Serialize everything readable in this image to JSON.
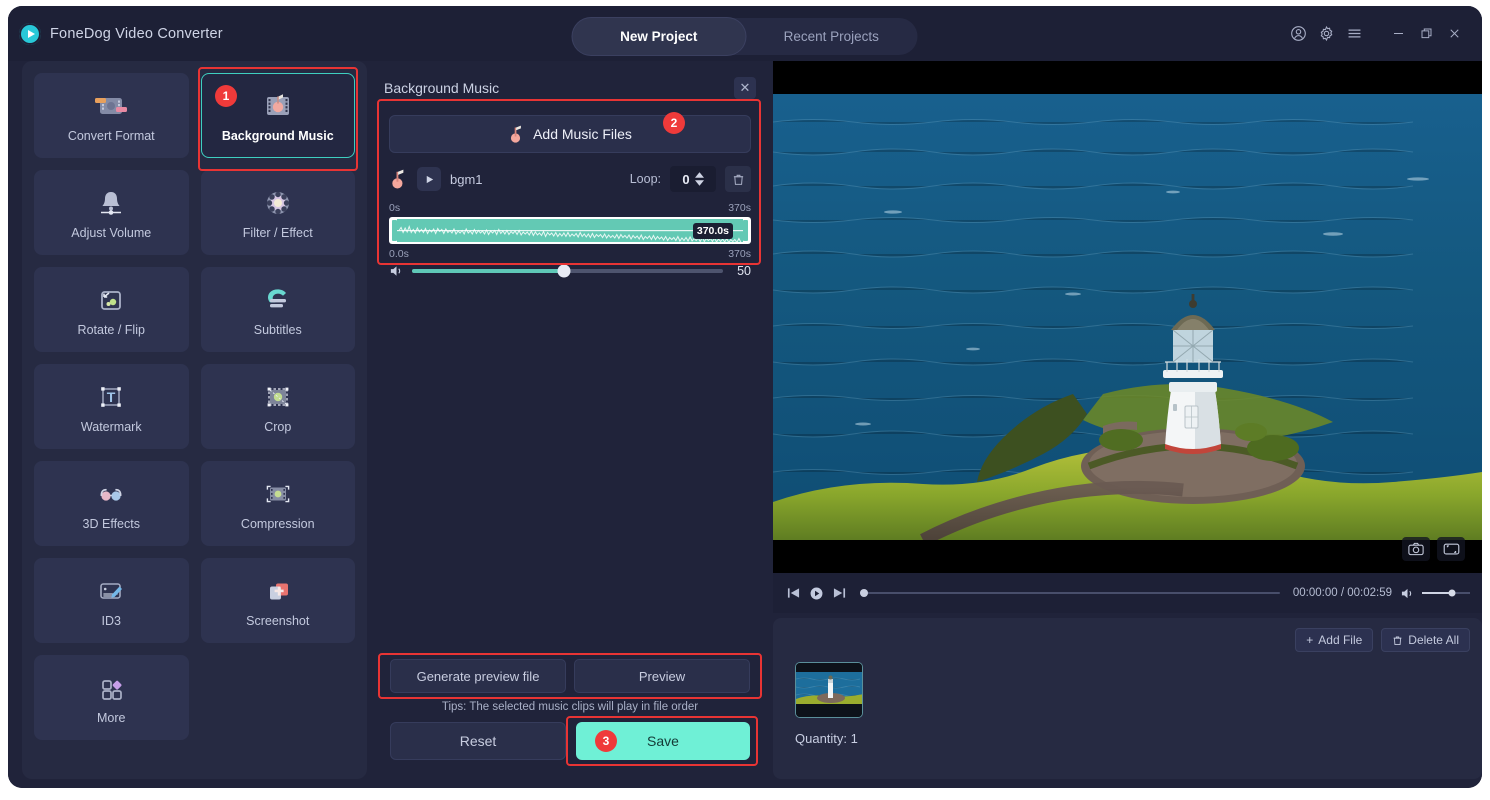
{
  "app": {
    "title": "FoneDog Video Converter",
    "logo_icon": "play-circle-icon"
  },
  "titlebar": {
    "tabs": [
      {
        "label": "New Project",
        "active": true
      },
      {
        "label": "Recent Projects",
        "active": false
      }
    ],
    "controls": [
      {
        "name": "account-icon",
        "glyph": "account"
      },
      {
        "name": "gear-icon",
        "glyph": "gear"
      },
      {
        "name": "menu-icon",
        "glyph": "menu"
      },
      {
        "name": "minimize-icon",
        "glyph": "minimize"
      },
      {
        "name": "restore-icon",
        "glyph": "restore"
      },
      {
        "name": "close-icon",
        "glyph": "close"
      }
    ]
  },
  "tools": {
    "items": [
      {
        "label": "Convert Format",
        "icon": "convert-format-icon",
        "selected": false
      },
      {
        "label": "Background Music",
        "icon": "background-music-icon",
        "selected": true
      },
      {
        "label": "Adjust Volume",
        "icon": "adjust-volume-icon",
        "selected": false
      },
      {
        "label": "Filter / Effect",
        "icon": "filter-effect-icon",
        "selected": false
      },
      {
        "label": "Rotate / Flip",
        "icon": "rotate-flip-icon",
        "selected": false
      },
      {
        "label": "Subtitles",
        "icon": "subtitles-icon",
        "selected": false
      },
      {
        "label": "Watermark",
        "icon": "watermark-icon",
        "selected": false
      },
      {
        "label": "Crop",
        "icon": "crop-icon",
        "selected": false
      },
      {
        "label": "3D Effects",
        "icon": "3d-effects-icon",
        "selected": false
      },
      {
        "label": "Compression",
        "icon": "compression-icon",
        "selected": false
      },
      {
        "label": "ID3",
        "icon": "id3-icon",
        "selected": false
      },
      {
        "label": "Screenshot",
        "icon": "screenshot-icon",
        "selected": false
      },
      {
        "label": "More",
        "icon": "more-icon",
        "selected": false
      }
    ]
  },
  "panel": {
    "title": "Background Music",
    "close_label": "✕",
    "add_music_label": "Add Music Files",
    "track": {
      "name": "bgm1",
      "loop_label": "Loop:",
      "loop_value": "0",
      "start_time_label": "0s",
      "end_time_label": "370s",
      "trim_start_label": "0.0s",
      "trim_end_label": "370s",
      "selection_badge": "370.0s",
      "volume_value": "50",
      "volume_percent": 49
    },
    "generate_preview_label": "Generate preview file",
    "preview_label": "Preview",
    "tips": "Tips: The selected music clips will play in file order",
    "reset_label": "Reset",
    "save_label": "Save"
  },
  "annotations": {
    "badges": [
      {
        "number": "1",
        "target": "background-music-tool"
      },
      {
        "number": "2",
        "target": "add-music-files-button"
      },
      {
        "number": "3",
        "target": "save-button"
      }
    ],
    "box_color": "#e83434"
  },
  "preview": {
    "player": {
      "prev_icon": "skip-previous-icon",
      "play_icon": "play-icon",
      "next_icon": "skip-next-icon",
      "time_display": "00:00:00 / 00:02:59",
      "volume_icon": "speaker-icon",
      "seek_percent": 0,
      "volume_percent": 62
    },
    "overlay_buttons": [
      {
        "name": "snapshot-icon"
      },
      {
        "name": "aspect-ratio-icon"
      }
    ]
  },
  "filelist": {
    "add_file_label": "Add File",
    "delete_all_label": "Delete All",
    "quantity_label": "Quantity: 1"
  },
  "colors": {
    "accent_teal": "#6ff0d6",
    "annotation_red": "#e83434",
    "panel_bg": "#262a42",
    "window_bg": "#20233a",
    "waveform": "#63c9b4"
  }
}
